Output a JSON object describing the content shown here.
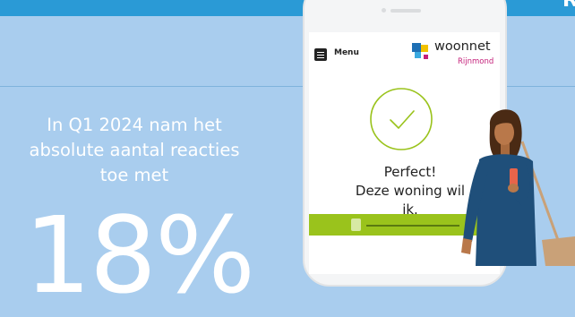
{
  "header": {
    "corner_text": "R"
  },
  "intro": {
    "line1": "In Q1 2024 nam het",
    "line2": "absolute aantal reacties",
    "line3": "toe met"
  },
  "stat": {
    "value": "18%"
  },
  "phone": {
    "menu_label": "Menu",
    "logo_name": "woonnet",
    "logo_sub": "Rijnmond",
    "confirm_line1": "Perfect!",
    "confirm_line2": "Deze woning wil",
    "confirm_line3": "ik."
  },
  "colors": {
    "background": "#a9cdee",
    "top_band": "#2a9ad6",
    "accent_green": "#9ac31c",
    "logo_magenta": "#c4207a"
  },
  "icons": [
    "hamburger-icon",
    "woonnet-logo-icon",
    "checkmark-circle-icon",
    "person-illustration"
  ]
}
